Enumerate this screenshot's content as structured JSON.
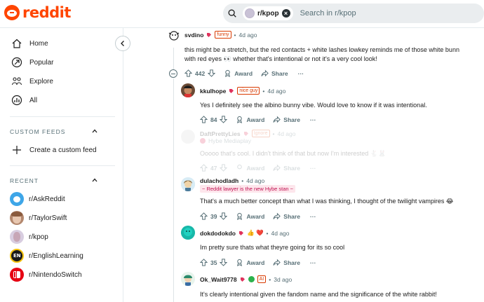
{
  "header": {
    "logo_text": "reddit",
    "search_chip": "r/kpop",
    "search_placeholder": "Search in r/kpop"
  },
  "sidebar": {
    "nav": [
      {
        "label": "Home",
        "icon": "home-icon"
      },
      {
        "label": "Popular",
        "icon": "popular-icon"
      },
      {
        "label": "Explore",
        "icon": "explore-icon"
      },
      {
        "label": "All",
        "icon": "all-icon"
      }
    ],
    "custom_feeds_title": "CUSTOM FEEDS",
    "create_feed": "Create a custom feed",
    "recent_title": "RECENT",
    "recent": [
      {
        "label": "r/AskReddit"
      },
      {
        "label": "r/TaylorSwift"
      },
      {
        "label": "r/kpop"
      },
      {
        "label": "r/EnglishLearning"
      },
      {
        "label": "r/NintendoSwitch"
      }
    ]
  },
  "comments": [
    {
      "author": "svdino",
      "flair": "funny",
      "time": "4d ago",
      "lines": [
        "this might be a stretch, but the red contacts + white lashes lowkey reminds me of those white bunn",
        "with red eyes 👀 whether that's intentional or not it's a very cool look!"
      ],
      "votes": "442",
      "award": "Award",
      "share": "Share"
    },
    {
      "author": "kkulhope",
      "flair": "nice guy",
      "time": "4d ago",
      "lines": [
        "Yes I definitely see the albino bunny vibe. Would love to know if it was intentional."
      ],
      "votes": "84",
      "award": "Award",
      "share": "Share"
    },
    {
      "author": "DaftPrettyLies",
      "flair": "Ignore",
      "time": "4d ago",
      "subflair": "Hybe Mediaplay",
      "lines": [
        "Ooooo that's cool. I didn't think of that but now I'm interested 🐇🐰"
      ],
      "votes": "47",
      "award": "Award",
      "share": "Share"
    },
    {
      "author": "dulachodladh",
      "time": "4d ago",
      "subflair": "~ Reddit lawyer is the new Hybe stan ~",
      "lines": [
        "That's a much better concept than what I was thinking, I thought of the twilight vampires 😂"
      ],
      "votes": "39",
      "award": "Award",
      "share": "Share"
    },
    {
      "author": "dokdodokdo",
      "emoji": "👍 ❤️",
      "time": "4d ago",
      "lines": [
        "Im pretty sure thats what theyre going for its so cool"
      ],
      "votes": "35",
      "award": "Award",
      "share": "Share"
    },
    {
      "author": "Ok_Wait9778",
      "flair": "AI",
      "time": "3d ago",
      "lines": [
        "It's clearly intentional given the fandom name and the significance of the white rabbit!"
      ]
    }
  ],
  "ui": {
    "dot": "•",
    "more": "···"
  }
}
